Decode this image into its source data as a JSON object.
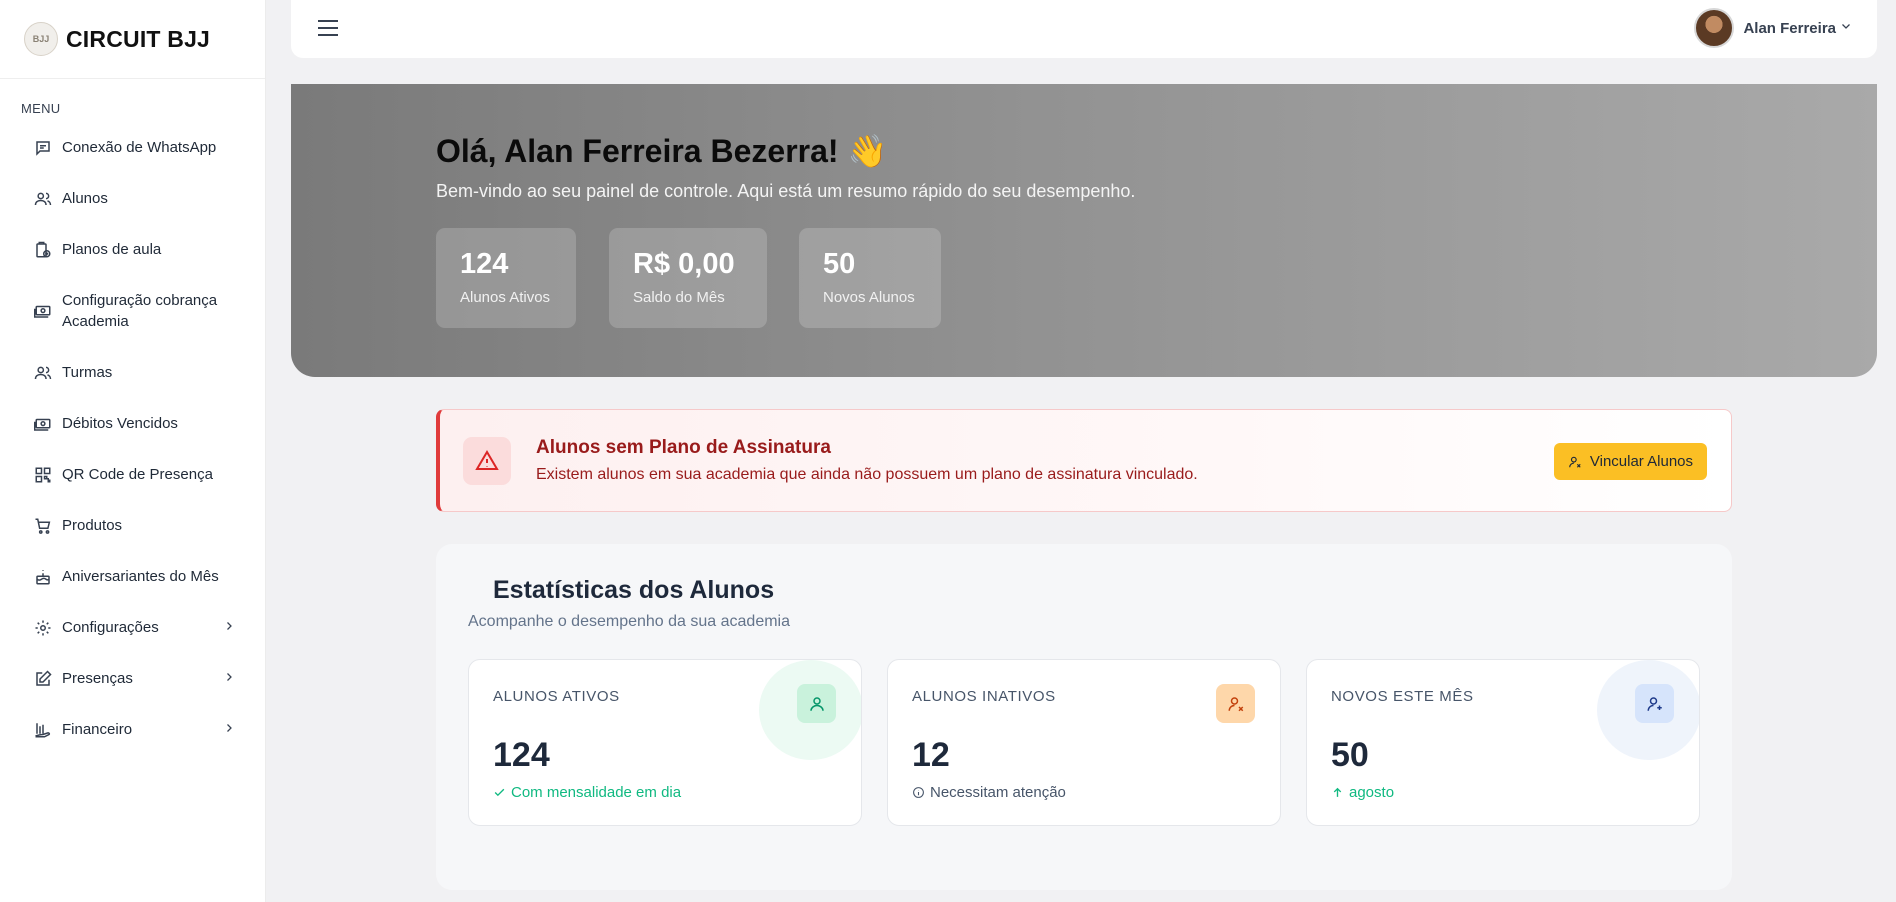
{
  "brand": {
    "logo_text": "BJJ",
    "name": "CIRCUIT BJJ"
  },
  "sidebar": {
    "menu_title": "MENU",
    "items": [
      {
        "label": "Conexão de WhatsApp",
        "icon": "message-icon"
      },
      {
        "label": "Alunos",
        "icon": "users-icon"
      },
      {
        "label": "Planos de aula",
        "icon": "clipboard-plus-icon"
      },
      {
        "label": "Configuração cobrança Academia",
        "icon": "cash-icon"
      },
      {
        "label": "Turmas",
        "icon": "users-icon"
      },
      {
        "label": "Débitos Vencidos",
        "icon": "cash-icon"
      },
      {
        "label": "QR Code de Presença",
        "icon": "qrcode-icon"
      },
      {
        "label": "Produtos",
        "icon": "cart-icon"
      },
      {
        "label": "Aniversariantes do Mês",
        "icon": "cake-icon"
      },
      {
        "label": "Configurações",
        "icon": "gear-icon"
      },
      {
        "label": "Presenças",
        "icon": "edit-icon"
      },
      {
        "label": "Financeiro",
        "icon": "chart-hand-icon"
      }
    ]
  },
  "topbar": {
    "user_name": "Alan Ferreira"
  },
  "hero": {
    "title": "Olá, Alan Ferreira Bezerra! 👋",
    "subtitle": "Bem-vindo ao seu painel de controle. Aqui está um resumo rápido do seu desempenho.",
    "cards": [
      {
        "value": "124",
        "label": "Alunos Ativos"
      },
      {
        "value": "R$ 0,00",
        "label": "Saldo do Mês"
      },
      {
        "value": "50",
        "label": "Novos Alunos"
      }
    ]
  },
  "alert": {
    "title": "Alunos sem Plano de Assinatura",
    "text": "Existem alunos em sua academia que ainda não possuem um plano de assinatura vinculado.",
    "button": "Vincular Alunos"
  },
  "stats": {
    "title": "Estatísticas dos Alunos",
    "subtitle": "Acompanhe o desempenho da sua academia",
    "cards": [
      {
        "label": "ALUNOS ATIVOS",
        "value": "124",
        "note": "Com mensalidade em dia",
        "note_color": "#10b981",
        "icon": "user-icon"
      },
      {
        "label": "ALUNOS INATIVOS",
        "value": "12",
        "note": "Necessitam atenção",
        "note_color": "#475569",
        "icon": "user-x-icon"
      },
      {
        "label": "NOVOS ESTE MÊS",
        "value": "50",
        "note": "agosto",
        "note_color": "#10b981",
        "icon": "user-plus-icon"
      }
    ]
  },
  "colors": {
    "accent": "#fbbf24",
    "danger": "#e03b3b",
    "success": "#10b981"
  }
}
